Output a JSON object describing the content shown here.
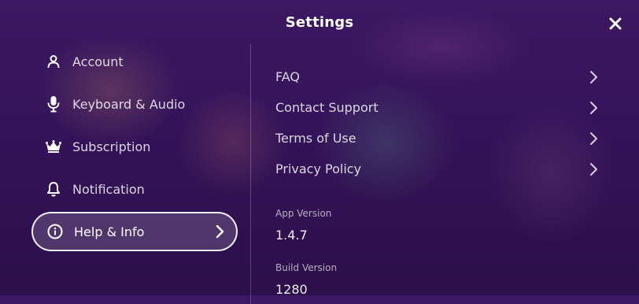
{
  "header": {
    "title": "Settings"
  },
  "sidebar": {
    "items": [
      {
        "label": "Account",
        "icon": "person-icon"
      },
      {
        "label": "Keyboard & Audio",
        "icon": "microphone-icon"
      },
      {
        "label": "Subscription",
        "icon": "crown-icon"
      },
      {
        "label": "Notification",
        "icon": "bell-icon"
      },
      {
        "label": "Help & Info",
        "icon": "info-icon",
        "active": true
      }
    ]
  },
  "help": {
    "links": [
      {
        "label": "FAQ"
      },
      {
        "label": "Contact Support"
      },
      {
        "label": "Terms of Use"
      },
      {
        "label": "Privacy Policy"
      }
    ],
    "app_version_label": "App Version",
    "app_version": "1.4.7",
    "build_version_label": "Build Version",
    "build_version": "1280"
  },
  "colors": {
    "background": "#35135a",
    "text": "#ffffff"
  }
}
